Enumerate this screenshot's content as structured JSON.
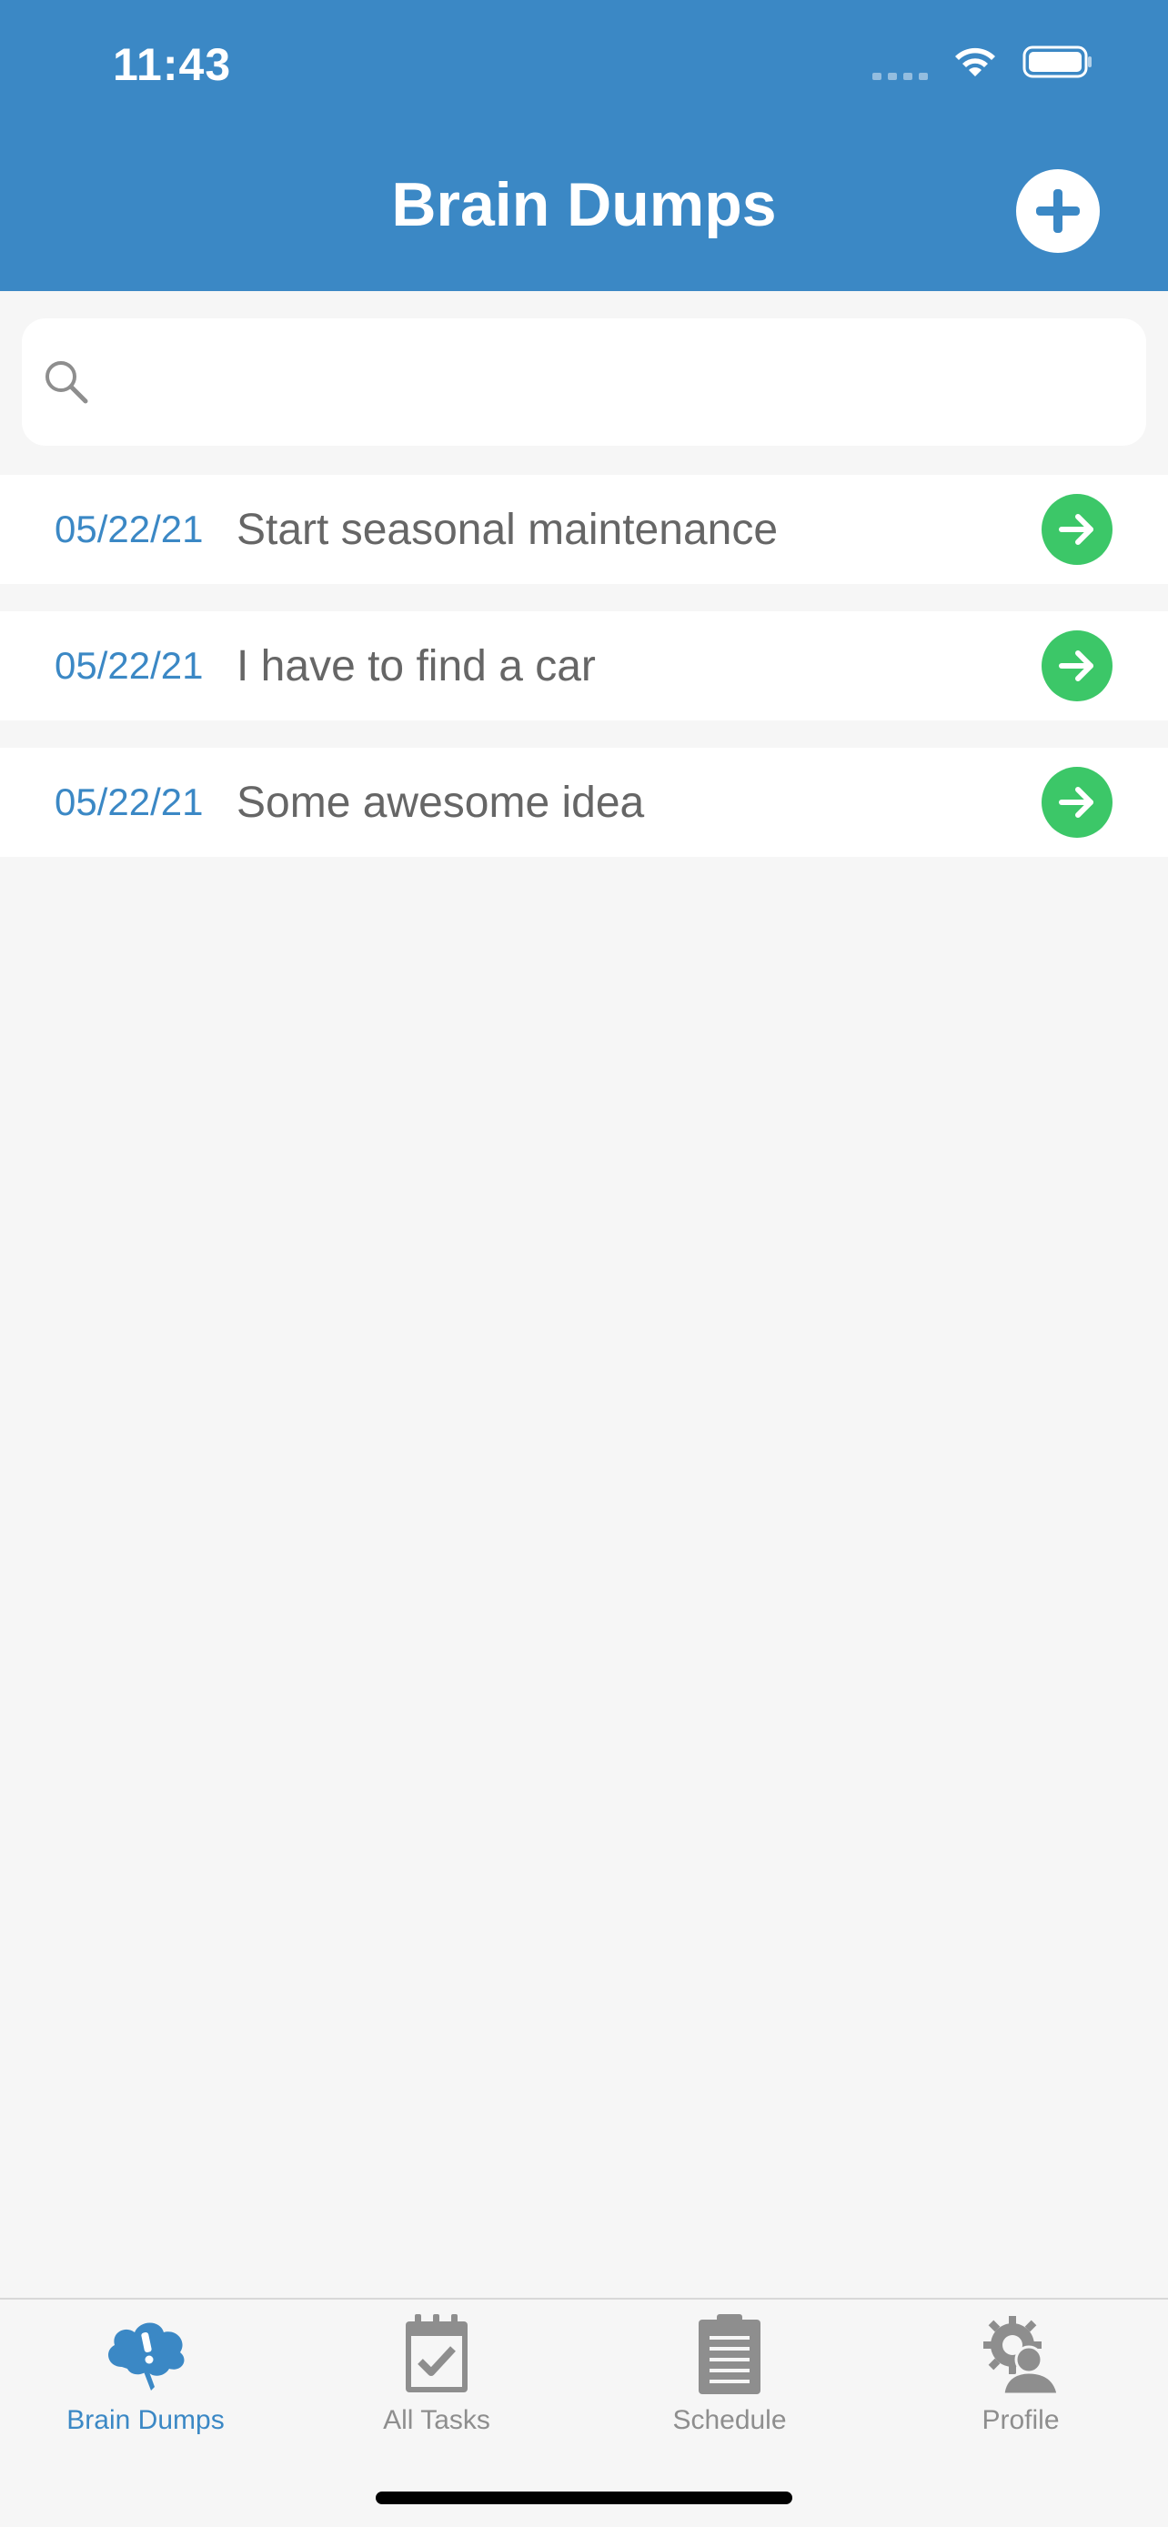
{
  "status_bar": {
    "time": "11:43"
  },
  "header": {
    "title": "Brain Dumps",
    "add_icon": "plus-circle-icon"
  },
  "search": {
    "value": "",
    "placeholder": "",
    "icon": "search-icon"
  },
  "items": [
    {
      "date": "05/22/21",
      "title": "Start seasonal maintenance"
    },
    {
      "date": "05/22/21",
      "title": "I have to find a car"
    },
    {
      "date": "05/22/21",
      "title": "Some awesome idea"
    }
  ],
  "tabs": [
    {
      "label": "Brain Dumps",
      "icon": "brain-cloud-icon",
      "active": true
    },
    {
      "label": "All Tasks",
      "icon": "calendar-check-icon",
      "active": false
    },
    {
      "label": "Schedule",
      "icon": "clipboard-icon",
      "active": false
    },
    {
      "label": "Profile",
      "icon": "profile-gear-icon",
      "active": false
    }
  ],
  "colors": {
    "primary": "#3b88c5",
    "arrow_green": "#3cc768",
    "background": "#f6f6f6",
    "inactive": "#8e8e8e"
  }
}
